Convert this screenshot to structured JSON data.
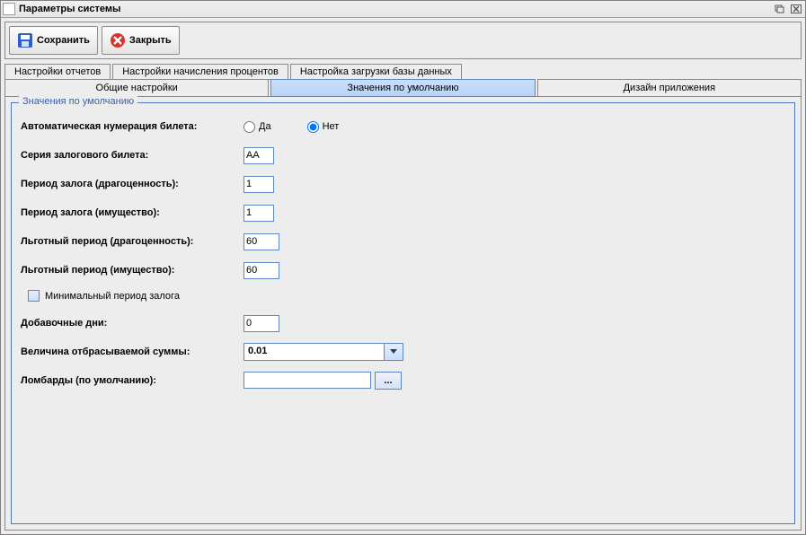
{
  "window": {
    "title": "Параметры системы"
  },
  "toolbar": {
    "save_label": "Сохранить",
    "close_label": "Закрыть"
  },
  "tabs_row1": [
    {
      "label": "Настройки отчетов"
    },
    {
      "label": "Настройки начисления процентов"
    },
    {
      "label": "Настройка загрузки базы данных"
    }
  ],
  "tabs_row2": [
    {
      "label": "Общие настройки"
    },
    {
      "label": "Значения по умолчанию",
      "selected": true
    },
    {
      "label": "Дизайн приложения"
    }
  ],
  "group": {
    "title": "Значения по умолчанию"
  },
  "form": {
    "auto_num_label": "Автоматическая нумерация билета:",
    "radio_yes": "Да",
    "radio_no": "Нет",
    "radio_selected": "no",
    "series_label": "Серия залогового билета:",
    "series_value": "AA",
    "period_prec_label": "Период залога (драгоценность):",
    "period_prec_value": "1",
    "period_prop_label": "Период залога (имущество):",
    "period_prop_value": "1",
    "grace_prec_label": "Льготный период (драгоценность):",
    "grace_prec_value": "60",
    "grace_prop_label": "Льготный период (имущество):",
    "grace_prop_value": "60",
    "min_period_label": "Минимальный период залога",
    "min_period_checked": false,
    "add_days_label": "Добавочные дни:",
    "add_days_value": "0",
    "discard_label": "Величина отбрасываемой суммы:",
    "discard_value": "0.01",
    "pawnshops_label": "Ломбарды (по умолчанию):",
    "pawnshops_value": "",
    "picker_btn_label": "..."
  }
}
